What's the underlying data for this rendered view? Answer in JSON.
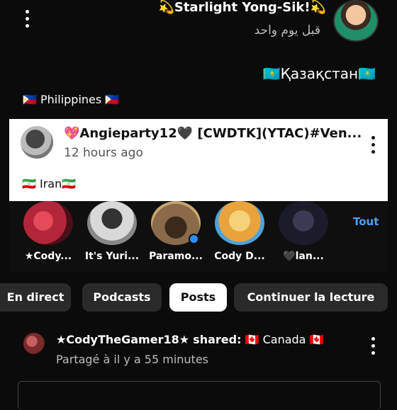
{
  "top_post": {
    "author": "💫Starlight Yong-Sik!💫",
    "time": "قبل يوم واحد",
    "body_line_1": "🇰🇿Қазақстан🇰🇿",
    "body_line_2": "🇵🇭 Philippines 🇵🇭"
  },
  "card_post": {
    "author": "💖Angieparty12🖤 [CWDTK](YTAC)#Ven...",
    "time": "12 hours ago",
    "body": "🇮🇷 Iran🇮🇷"
  },
  "stories": {
    "items": [
      {
        "name": "★Cody...",
        "color": "#b3263a"
      },
      {
        "name": "It's Yuri...",
        "color": "#d9d9d9"
      },
      {
        "name": "Paramo...",
        "color": "#8a6a4a"
      },
      {
        "name": "Cody D...",
        "color": "#e8a33d"
      },
      {
        "name": "🖤lan...",
        "color": "#1b1b2a"
      }
    ],
    "see_all": "Tout"
  },
  "tabs": [
    {
      "label": "En direct"
    },
    {
      "label": "Podcasts"
    },
    {
      "label": "Posts"
    },
    {
      "label": "Continuer la lecture"
    }
  ],
  "shared_post": {
    "author": "★CodyTheGamer18★",
    "action": "shared:",
    "target": "🇨🇦 Canada 🇨🇦",
    "time": "Partagé à il y a 55 minutes"
  },
  "colors": {
    "background": "#0b0b0b",
    "card": "#ffffff",
    "accent": "#4ea1ff"
  }
}
